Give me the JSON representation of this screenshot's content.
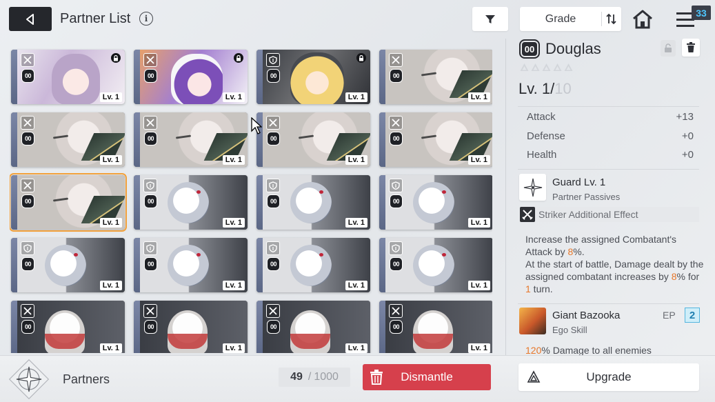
{
  "header": {
    "title": "Partner List",
    "sort_label": "Grade",
    "notification_count": "33"
  },
  "cards": [
    {
      "art": "girl1",
      "cls": "striker",
      "grade": "00",
      "locked": true,
      "level": "Lv. 1"
    },
    {
      "art": "girl2",
      "cls": "striker",
      "grade": "00",
      "locked": true,
      "level": "Lv. 1"
    },
    {
      "art": "girl3",
      "cls": "guard",
      "grade": "00",
      "locked": true,
      "level": "Lv. 1"
    },
    {
      "art": "a",
      "cls": "striker",
      "grade": "00",
      "locked": false,
      "level": "Lv. 1"
    },
    {
      "art": "a",
      "cls": "striker",
      "grade": "00",
      "locked": false,
      "level": "Lv. 1"
    },
    {
      "art": "a",
      "cls": "striker",
      "grade": "00",
      "locked": false,
      "level": "Lv. 1"
    },
    {
      "art": "a",
      "cls": "striker",
      "grade": "00",
      "locked": false,
      "level": "Lv. 1"
    },
    {
      "art": "a",
      "cls": "striker",
      "grade": "00",
      "locked": false,
      "level": "Lv. 1"
    },
    {
      "art": "a",
      "cls": "striker",
      "grade": "00",
      "locked": false,
      "level": "Lv. 1",
      "selected": true
    },
    {
      "art": "b",
      "cls": "guard",
      "grade": "00",
      "locked": false,
      "level": "Lv. 1"
    },
    {
      "art": "b",
      "cls": "guard",
      "grade": "00",
      "locked": false,
      "level": "Lv. 1"
    },
    {
      "art": "b",
      "cls": "guard",
      "grade": "00",
      "locked": false,
      "level": "Lv. 1"
    },
    {
      "art": "b",
      "cls": "guard",
      "grade": "00",
      "locked": false,
      "level": "Lv. 1"
    },
    {
      "art": "b",
      "cls": "guard",
      "grade": "00",
      "locked": false,
      "level": "Lv. 1"
    },
    {
      "art": "b",
      "cls": "guard",
      "grade": "00",
      "locked": false,
      "level": "Lv. 1"
    },
    {
      "art": "b",
      "cls": "guard",
      "grade": "00",
      "locked": false,
      "level": "Lv. 1"
    },
    {
      "art": "c",
      "cls": "striker",
      "grade": "00",
      "locked": false,
      "level": "Lv. 1"
    },
    {
      "art": "c",
      "cls": "striker",
      "grade": "00",
      "locked": false,
      "level": "Lv. 1"
    },
    {
      "art": "c",
      "cls": "striker",
      "grade": "00",
      "locked": false,
      "level": "Lv. 1"
    },
    {
      "art": "c",
      "cls": "striker",
      "grade": "00",
      "locked": false,
      "level": "Lv. 1"
    }
  ],
  "detail": {
    "grade_badge": "00",
    "name": "Douglas",
    "level_prefix": "Lv. ",
    "level_current": "1",
    "level_max": "10",
    "stats": [
      {
        "label": "Attack",
        "value": "+13"
      },
      {
        "label": "Defense",
        "value": "+0"
      },
      {
        "label": "Health",
        "value": "+0"
      }
    ],
    "passive_name": "Guard Lv. 1",
    "passive_type": "Partner Passives",
    "additional_effect": "Striker Additional Effect",
    "desc_1": "Increase the assigned Combatant's Attack by ",
    "desc_pct1": "8",
    "desc_2": "%.",
    "desc_3": "At the start of battle, Damage dealt by the assigned combatant increases by ",
    "desc_pct2": "8",
    "desc_4": "% for ",
    "desc_turns": "1",
    "desc_5": " turn.",
    "ego_name": "Giant Bazooka",
    "ego_type": "Ego Skill",
    "ep_label": "EP",
    "ep_value": "2",
    "ego_desc_pct": "120",
    "ego_desc": "% Damage to all enemies"
  },
  "footer": {
    "section_label": "Partners",
    "count_current": "49",
    "count_max": "1000",
    "dismantle_label": "Dismantle",
    "upgrade_label": "Upgrade"
  },
  "colors": {
    "accent_red": "#d6404c",
    "highlight_orange": "#e7772a",
    "selected_outline": "#f3a13b",
    "ep_blue": "#54b5de"
  }
}
